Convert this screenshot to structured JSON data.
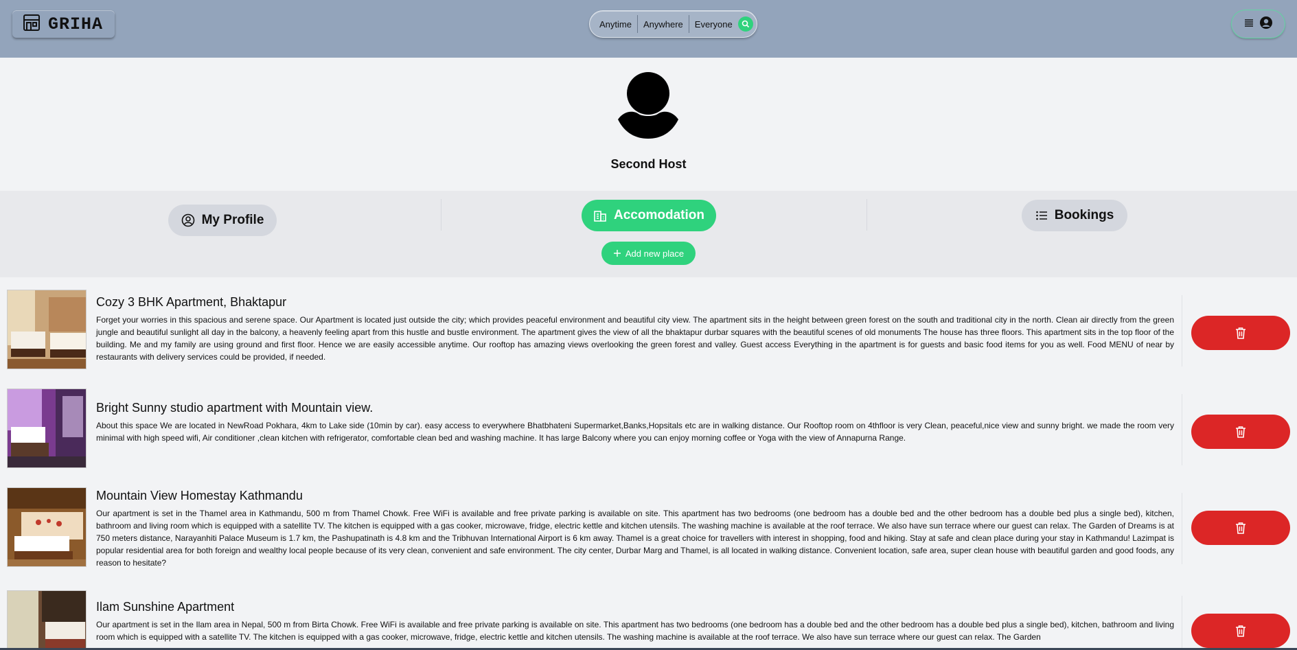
{
  "header": {
    "logo_text": "GRIHA",
    "search": {
      "anytime": "Anytime",
      "anywhere": "Anywhere",
      "everyone": "Everyone"
    }
  },
  "profile": {
    "name": "Second Host"
  },
  "tabs": {
    "my_profile": "My Profile",
    "accommodation": "Accomodation",
    "bookings": "Bookings",
    "add_new_place": "Add new place"
  },
  "colors": {
    "accent": "#2fd27d",
    "delete": "#dc2626",
    "header": "#93a4bb"
  },
  "listings": [
    {
      "title": "Cozy 3 BHK Apartment, Bhaktapur",
      "description": "Forget your worries in this spacious and serene space. Our Apartment is located just outside the city; which provides peaceful environment and beautiful city view. The apartment sits in the height between green forest on the south and traditional city in the north. Clean air directly from the green jungle and beautiful sunlight all day in the balcony, a heavenly feeling apart from this hustle and bustle environment. The apartment gives the view of all the bhaktapur durbar squares with the beautiful scenes of old monuments The house has three floors. This apartment sits in the top floor of the building. Me and my family are using ground and first floor. Hence we are easily accessible anytime. Our rooftop has amazing views overlooking the green forest and valley. Guest access Everything in the apartment is for guests and basic food items for you as well. Food MENU of near by restaurants with delivery services could be provided, if needed."
    },
    {
      "title": "Bright Sunny studio apartment with Mountain view.",
      "description": "About this space We are located in NewRoad Pokhara, 4km to Lake side (10min by car). easy access to everywhere Bhatbhateni Supermarket,Banks,Hopsitals etc are in walking distance. Our Rooftop room on 4thfloor is very Clean, peaceful,nice view and sunny bright. we made the room very minimal with high speed wifi, Air conditioner ,clean kitchen with refrigerator, comfortable clean bed and washing machine. It has large Balcony where you can enjoy morning coffee or Yoga with the view of Annapurna Range."
    },
    {
      "title": "Mountain View Homestay Kathmandu",
      "description": "Our apartment is set in the Thamel area in Kathmandu, 500 m from Thamel Chowk. Free WiFi is available and free private parking is available on site. This apartment has two bedrooms (one bedroom has a double bed and the other bedroom has a double bed plus a single bed), kitchen, bathroom and living room which is equipped with a satellite TV. The kitchen is equipped with a gas cooker, microwave, fridge, electric kettle and kitchen utensils. The washing machine is available at the roof terrace. We also have sun terrace where our guest can relax. The Garden of Dreams is at 750 meters distance, Narayanhiti Palace Museum is 1.7 km, the Pashupatinath is 4.8 km and the Tribhuvan International Airport is 6 km away. Thamel is a great choice for travellers with interest in shopping, food and hiking. Stay at safe and clean place during your stay in Kathmandu! Lazimpat is popular residential area for both foreign and wealthy local people because of its very clean, convenient and safe environment. The city center, Durbar Marg and Thamel, is all located in walking distance. Convenient location, safe area, super clean house with beautiful garden and good foods, any reason to hesitate?"
    },
    {
      "title": "Ilam Sunshine Apartment",
      "description": "Our apartment is set in the Ilam area in Nepal, 500 m from Birta Chowk. Free WiFi is available and free private parking is available on site. This apartment has two bedrooms (one bedroom has a double bed and the other bedroom has a double bed plus a single bed), kitchen, bathroom and living room which is equipped with a satellite TV. The kitchen is equipped with a gas cooker, microwave, fridge, electric kettle and kitchen utensils. The washing machine is available at the roof terrace. We also have sun terrace where our guest can relax. The Garden"
    }
  ]
}
